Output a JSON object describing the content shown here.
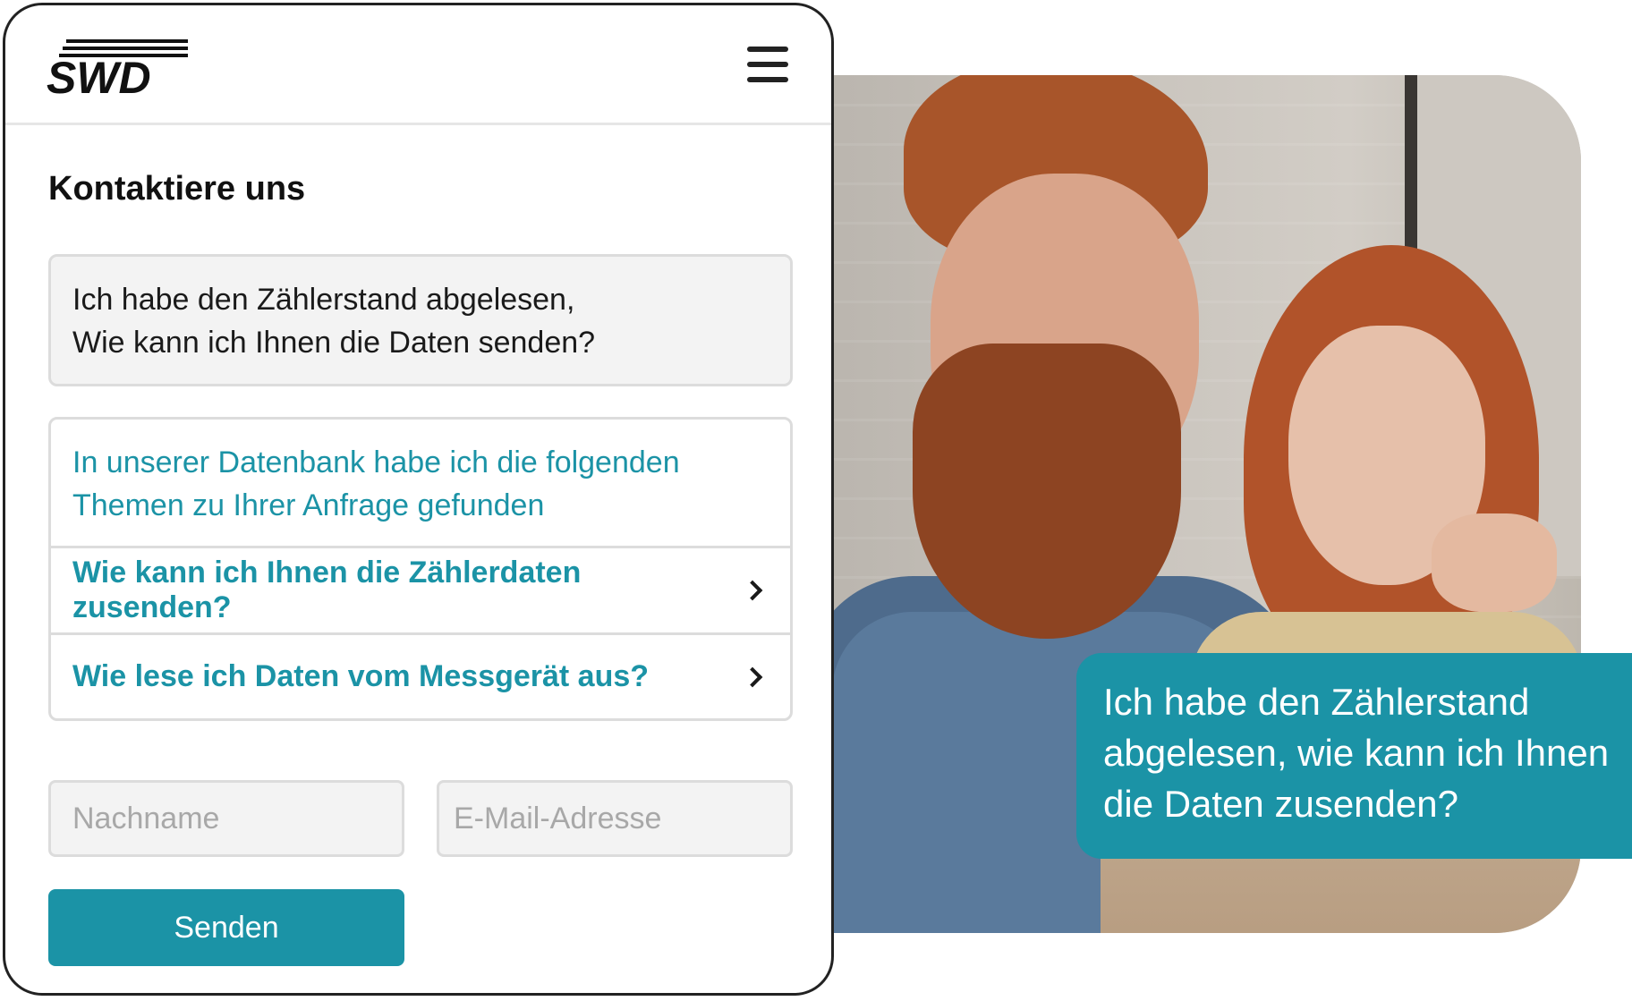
{
  "brand": {
    "logo_text": "SWD",
    "accent_color": "#1b93a6"
  },
  "header": {
    "menu_icon": "hamburger-menu-icon"
  },
  "page": {
    "title": "Kontaktiere uns"
  },
  "question": {
    "line1": "Ich habe den Zählerstand abgelesen,",
    "line2": "Wie kann ich Ihnen die Daten senden?"
  },
  "answer": {
    "intro_line1": "In unserer Datenbank habe ich die folgenden",
    "intro_line2": "Themen zu Ihrer Anfrage gefunden",
    "links": [
      {
        "label": "Wie kann ich Ihnen die Zählerdaten zusenden?",
        "icon": "chevron-right-icon"
      },
      {
        "label": "Wie lese ich Daten vom Messgerät aus?",
        "icon": "chevron-right-icon"
      }
    ]
  },
  "form": {
    "name_placeholder": "Nachname",
    "email_placeholder": "E-Mail-Adresse",
    "submit_label": "Senden"
  },
  "chat_bubble": {
    "line1": "Ich habe den Zählerstand",
    "line2": "abgelesen, wie kann ich Ihnen",
    "line3": "die Daten zusenden?"
  }
}
